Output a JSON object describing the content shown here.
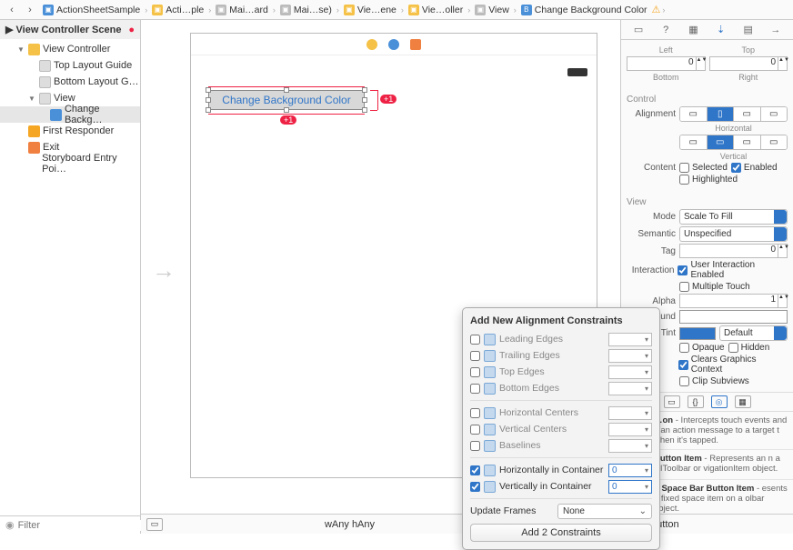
{
  "breadcrumb": {
    "items": [
      {
        "label": "ActionSheetSample"
      },
      {
        "label": "Acti…ple"
      },
      {
        "label": "Mai…ard"
      },
      {
        "label": "Mai…se)"
      },
      {
        "label": "Vie…ene"
      },
      {
        "label": "Vie…oller"
      },
      {
        "label": "View"
      },
      {
        "label": "Change Background Color"
      }
    ]
  },
  "outline": {
    "title": "View Controller Scene",
    "rows": [
      {
        "label": "View Controller",
        "indent": 1,
        "icon": "vc",
        "disc": "▼"
      },
      {
        "label": "Top Layout Guide",
        "indent": 2,
        "icon": "vw"
      },
      {
        "label": "Bottom Layout G…",
        "indent": 2,
        "icon": "vw"
      },
      {
        "label": "View",
        "indent": 2,
        "icon": "vw",
        "disc": "▼"
      },
      {
        "label": "Change Backg…",
        "indent": 3,
        "icon": "b",
        "sel": true
      },
      {
        "label": "First Responder",
        "indent": 1,
        "icon": "fr"
      },
      {
        "label": "Exit",
        "indent": 1,
        "icon": "ex"
      },
      {
        "label": "Storyboard Entry Poi…",
        "indent": 1,
        "icon": ""
      }
    ],
    "filter_placeholder": "Filter"
  },
  "canvas": {
    "button_text": "Change Background Color",
    "badge_right": "+1",
    "badge_bottom": "+1",
    "size_label_w": "wAny",
    "size_label_h": "hAny"
  },
  "inspector": {
    "spacing": {
      "left_lbl": "Left",
      "top_lbl": "Top",
      "bottom_lbl": "Bottom",
      "right_lbl": "Right",
      "left_val": "0",
      "top_val": "0"
    },
    "control_title": "Control",
    "alignment_lbl": "Alignment",
    "horizontal_lbl": "Horizontal",
    "vertical_lbl": "Vertical",
    "content_lbl": "Content",
    "selected_lbl": "Selected",
    "enabled_lbl": "Enabled",
    "highlighted_lbl": "Highlighted",
    "view_title": "View",
    "mode_lbl": "Mode",
    "mode_val": "Scale To Fill",
    "semantic_lbl": "Semantic",
    "semantic_val": "Unspecified",
    "tag_lbl": "Tag",
    "tag_val": "0",
    "interaction_lbl": "Interaction",
    "uie_lbl": "User Interaction Enabled",
    "mt_lbl": "Multiple Touch",
    "alpha_lbl": "Alpha",
    "alpha_val": "1",
    "bg_lbl": "Background",
    "tint_lbl": "Tint",
    "tint_val": "Default",
    "opaque_lbl": "Opaque",
    "hidden_lbl": "Hidden",
    "cgc_lbl": "Clears Graphics Context",
    "clip_lbl": "Clip Subviews",
    "lib": [
      {
        "t": "…on",
        "d": "Intercepts touch events and s an action message to a target t when it's tapped."
      },
      {
        "t": "Button Item",
        "d": "Represents an n a UIToolbar or vigationItem object."
      },
      {
        "t": "d Space Bar Button Item",
        "d": "esents a fixed space item on a olbar object."
      }
    ],
    "foot_label": "Button"
  },
  "popover": {
    "title": "Add New Alignment Constraints",
    "rows": [
      {
        "label": "Leading Edges"
      },
      {
        "label": "Trailing Edges"
      },
      {
        "label": "Top Edges"
      },
      {
        "label": "Bottom Edges"
      },
      {
        "label": "Horizontal Centers"
      },
      {
        "label": "Vertical Centers"
      },
      {
        "label": "Baselines"
      },
      {
        "label": "Horizontally in Container",
        "on": true,
        "val": "0"
      },
      {
        "label": "Vertically in Container",
        "on": true,
        "val": "0"
      }
    ],
    "update_lbl": "Update Frames",
    "update_val": "None",
    "add_btn": "Add 2 Constraints"
  }
}
